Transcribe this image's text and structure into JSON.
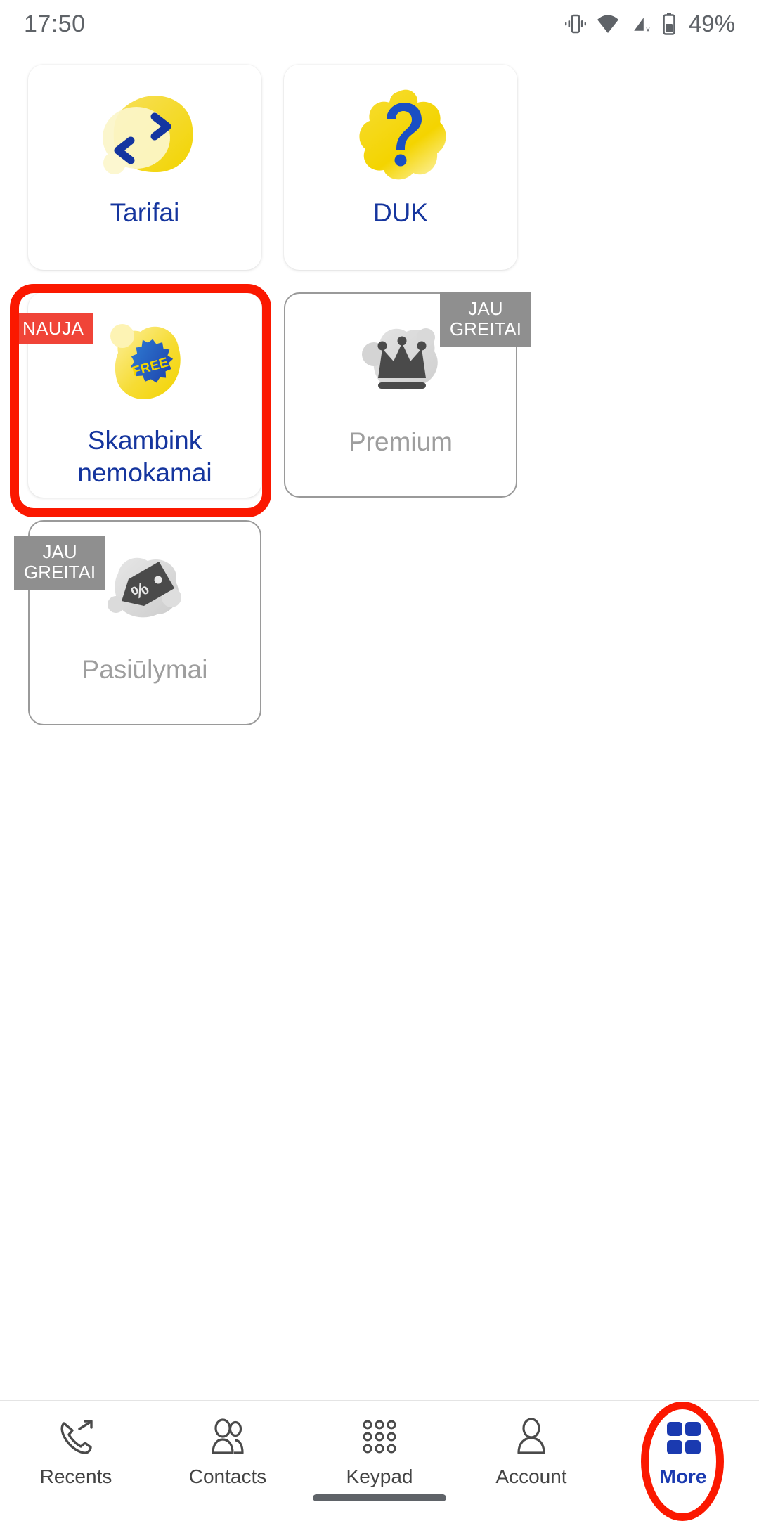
{
  "statusbar": {
    "time": "17:50",
    "battery_percent": "49%",
    "icons": [
      "vibrate-icon",
      "wifi-icon",
      "cellular-off-icon",
      "battery-icon"
    ]
  },
  "colors": {
    "brand_blue": "#15359e",
    "accent_yellow": "#f5d711",
    "badge_new_red": "#f04438",
    "badge_soon_gray": "#8f8f8f",
    "highlight_red": "#fb1800",
    "disabled_gray": "#9e9e9e"
  },
  "grid": {
    "cards": [
      {
        "id": "tarifai",
        "label": "Tarifai",
        "icon": "transfer-arrows-icon",
        "disabled": false,
        "badge": null
      },
      {
        "id": "duk",
        "label": "DUK",
        "icon": "question-mark-icon",
        "disabled": false,
        "badge": null
      },
      {
        "id": "skambink-nemokamai",
        "label": "Skambink nemokamai",
        "label_line1": "Skambink",
        "label_line2": "nemokamai",
        "icon": "free-starburst-icon",
        "icon_text": "FREE",
        "disabled": false,
        "badge": "NAUJA",
        "highlighted": true
      },
      {
        "id": "premium",
        "label": "Premium",
        "icon": "crown-icon",
        "disabled": true,
        "badge": "JAU\nGREITAI"
      },
      {
        "id": "pasiulymai",
        "label": "Pasiūlymai",
        "icon": "price-tag-percent-icon",
        "disabled": true,
        "badge": "JAU\nGREITAI"
      }
    ]
  },
  "navbar": {
    "items": [
      {
        "label": "Recents",
        "icon": "phone-outgoing-icon",
        "active": false
      },
      {
        "label": "Contacts",
        "icon": "contacts-people-icon",
        "active": false
      },
      {
        "label": "Keypad",
        "icon": "keypad-dots-icon",
        "active": false
      },
      {
        "label": "Account",
        "icon": "person-icon",
        "active": false
      },
      {
        "label": "More",
        "icon": "grid-squares-icon",
        "active": true,
        "highlighted": true
      }
    ]
  }
}
